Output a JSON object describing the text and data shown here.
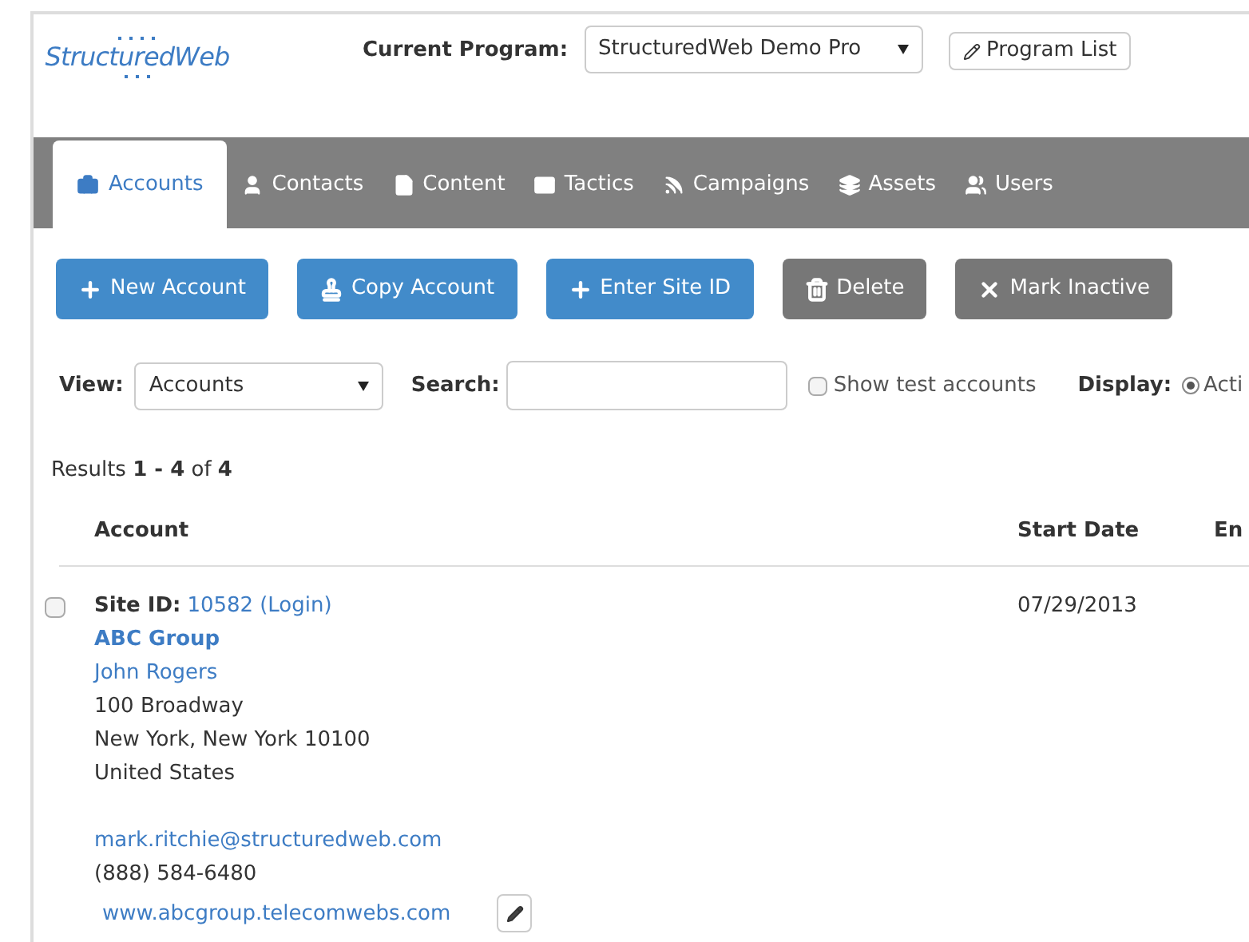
{
  "header": {
    "logo": "StructuredWeb",
    "program_label": "Current Program:",
    "program_value": "StructuredWeb Demo Pro",
    "program_list_button": "Program List"
  },
  "nav_tabs": [
    {
      "label": "Accounts",
      "selected": true
    },
    {
      "label": "Contacts",
      "selected": false
    },
    {
      "label": "Content",
      "selected": false
    },
    {
      "label": "Tactics",
      "selected": false
    },
    {
      "label": "Campaigns",
      "selected": false
    },
    {
      "label": "Assets",
      "selected": false
    },
    {
      "label": "Users",
      "selected": false
    }
  ],
  "actions": [
    {
      "label": "New Account",
      "kind": "primary"
    },
    {
      "label": "Copy Account",
      "kind": "primary"
    },
    {
      "label": "Enter Site ID",
      "kind": "primary"
    },
    {
      "label": "Delete",
      "kind": "secondary"
    },
    {
      "label": "Mark Inactive",
      "kind": "secondary"
    }
  ],
  "filters": {
    "view_label": "View:",
    "view_value": "Accounts",
    "search_label": "Search:",
    "show_test": {
      "label": "Show test accounts",
      "checked": false
    },
    "display_label": "Display:",
    "display_option": {
      "label": "Acti",
      "selected": true
    }
  },
  "results": {
    "text": "Results **1 - 4** of **4**"
  },
  "table": {
    "columns": [
      "Account",
      "Start Date",
      "En"
    ],
    "rows": [
      {
        "checked": false,
        "site_id_label": "Site ID:",
        "site_id": "10582",
        "login": "(Login)",
        "name": "ABC Group",
        "contact": "John Rogers",
        "address": [
          "100 Broadway",
          "New York, New York 10100",
          "United States"
        ],
        "email": "mark.ritchie@structuredweb.com",
        "phone": "(888) 584-6480",
        "website": "www.abcgroup.telecomwebs.com",
        "start_date": "07/29/2013"
      }
    ]
  }
}
